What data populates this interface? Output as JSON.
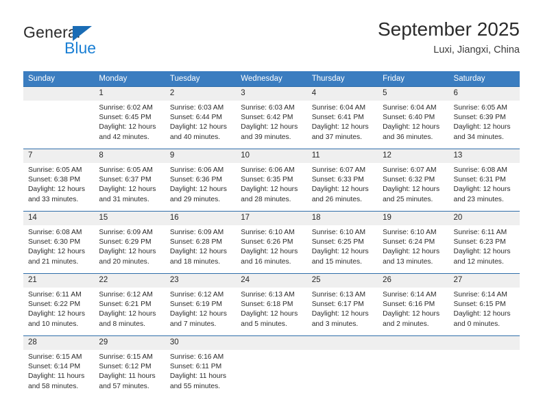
{
  "logo": {
    "word_top": "General",
    "word_bottom": "Blue",
    "triangle_color": "#1a6cb5",
    "blue_color": "#1a7fd4"
  },
  "header": {
    "title": "September 2025",
    "location": "Luxi, Jiangxi, China"
  },
  "theme": {
    "header_bg": "#3b7dc0",
    "header_text": "#ffffff",
    "daynum_bg": "#efefef",
    "row_border": "#2d6ca8",
    "body_text": "#2a2a2a"
  },
  "weekdays": [
    "Sunday",
    "Monday",
    "Tuesday",
    "Wednesday",
    "Thursday",
    "Friday",
    "Saturday"
  ],
  "labels": {
    "sunrise_prefix": "Sunrise:",
    "sunset_prefix": "Sunset:",
    "daylight_prefix": "Daylight:"
  },
  "weeks": [
    [
      {
        "day": "",
        "l1": "",
        "l2": "",
        "l3": "",
        "l4": ""
      },
      {
        "day": "1",
        "l1": "Sunrise: 6:02 AM",
        "l2": "Sunset: 6:45 PM",
        "l3": "Daylight: 12 hours",
        "l4": "and 42 minutes."
      },
      {
        "day": "2",
        "l1": "Sunrise: 6:03 AM",
        "l2": "Sunset: 6:44 PM",
        "l3": "Daylight: 12 hours",
        "l4": "and 40 minutes."
      },
      {
        "day": "3",
        "l1": "Sunrise: 6:03 AM",
        "l2": "Sunset: 6:42 PM",
        "l3": "Daylight: 12 hours",
        "l4": "and 39 minutes."
      },
      {
        "day": "4",
        "l1": "Sunrise: 6:04 AM",
        "l2": "Sunset: 6:41 PM",
        "l3": "Daylight: 12 hours",
        "l4": "and 37 minutes."
      },
      {
        "day": "5",
        "l1": "Sunrise: 6:04 AM",
        "l2": "Sunset: 6:40 PM",
        "l3": "Daylight: 12 hours",
        "l4": "and 36 minutes."
      },
      {
        "day": "6",
        "l1": "Sunrise: 6:05 AM",
        "l2": "Sunset: 6:39 PM",
        "l3": "Daylight: 12 hours",
        "l4": "and 34 minutes."
      }
    ],
    [
      {
        "day": "7",
        "l1": "Sunrise: 6:05 AM",
        "l2": "Sunset: 6:38 PM",
        "l3": "Daylight: 12 hours",
        "l4": "and 33 minutes."
      },
      {
        "day": "8",
        "l1": "Sunrise: 6:05 AM",
        "l2": "Sunset: 6:37 PM",
        "l3": "Daylight: 12 hours",
        "l4": "and 31 minutes."
      },
      {
        "day": "9",
        "l1": "Sunrise: 6:06 AM",
        "l2": "Sunset: 6:36 PM",
        "l3": "Daylight: 12 hours",
        "l4": "and 29 minutes."
      },
      {
        "day": "10",
        "l1": "Sunrise: 6:06 AM",
        "l2": "Sunset: 6:35 PM",
        "l3": "Daylight: 12 hours",
        "l4": "and 28 minutes."
      },
      {
        "day": "11",
        "l1": "Sunrise: 6:07 AM",
        "l2": "Sunset: 6:33 PM",
        "l3": "Daylight: 12 hours",
        "l4": "and 26 minutes."
      },
      {
        "day": "12",
        "l1": "Sunrise: 6:07 AM",
        "l2": "Sunset: 6:32 PM",
        "l3": "Daylight: 12 hours",
        "l4": "and 25 minutes."
      },
      {
        "day": "13",
        "l1": "Sunrise: 6:08 AM",
        "l2": "Sunset: 6:31 PM",
        "l3": "Daylight: 12 hours",
        "l4": "and 23 minutes."
      }
    ],
    [
      {
        "day": "14",
        "l1": "Sunrise: 6:08 AM",
        "l2": "Sunset: 6:30 PM",
        "l3": "Daylight: 12 hours",
        "l4": "and 21 minutes."
      },
      {
        "day": "15",
        "l1": "Sunrise: 6:09 AM",
        "l2": "Sunset: 6:29 PM",
        "l3": "Daylight: 12 hours",
        "l4": "and 20 minutes."
      },
      {
        "day": "16",
        "l1": "Sunrise: 6:09 AM",
        "l2": "Sunset: 6:28 PM",
        "l3": "Daylight: 12 hours",
        "l4": "and 18 minutes."
      },
      {
        "day": "17",
        "l1": "Sunrise: 6:10 AM",
        "l2": "Sunset: 6:26 PM",
        "l3": "Daylight: 12 hours",
        "l4": "and 16 minutes."
      },
      {
        "day": "18",
        "l1": "Sunrise: 6:10 AM",
        "l2": "Sunset: 6:25 PM",
        "l3": "Daylight: 12 hours",
        "l4": "and 15 minutes."
      },
      {
        "day": "19",
        "l1": "Sunrise: 6:10 AM",
        "l2": "Sunset: 6:24 PM",
        "l3": "Daylight: 12 hours",
        "l4": "and 13 minutes."
      },
      {
        "day": "20",
        "l1": "Sunrise: 6:11 AM",
        "l2": "Sunset: 6:23 PM",
        "l3": "Daylight: 12 hours",
        "l4": "and 12 minutes."
      }
    ],
    [
      {
        "day": "21",
        "l1": "Sunrise: 6:11 AM",
        "l2": "Sunset: 6:22 PM",
        "l3": "Daylight: 12 hours",
        "l4": "and 10 minutes."
      },
      {
        "day": "22",
        "l1": "Sunrise: 6:12 AM",
        "l2": "Sunset: 6:21 PM",
        "l3": "Daylight: 12 hours",
        "l4": "and 8 minutes."
      },
      {
        "day": "23",
        "l1": "Sunrise: 6:12 AM",
        "l2": "Sunset: 6:19 PM",
        "l3": "Daylight: 12 hours",
        "l4": "and 7 minutes."
      },
      {
        "day": "24",
        "l1": "Sunrise: 6:13 AM",
        "l2": "Sunset: 6:18 PM",
        "l3": "Daylight: 12 hours",
        "l4": "and 5 minutes."
      },
      {
        "day": "25",
        "l1": "Sunrise: 6:13 AM",
        "l2": "Sunset: 6:17 PM",
        "l3": "Daylight: 12 hours",
        "l4": "and 3 minutes."
      },
      {
        "day": "26",
        "l1": "Sunrise: 6:14 AM",
        "l2": "Sunset: 6:16 PM",
        "l3": "Daylight: 12 hours",
        "l4": "and 2 minutes."
      },
      {
        "day": "27",
        "l1": "Sunrise: 6:14 AM",
        "l2": "Sunset: 6:15 PM",
        "l3": "Daylight: 12 hours",
        "l4": "and 0 minutes."
      }
    ],
    [
      {
        "day": "28",
        "l1": "Sunrise: 6:15 AM",
        "l2": "Sunset: 6:14 PM",
        "l3": "Daylight: 11 hours",
        "l4": "and 58 minutes."
      },
      {
        "day": "29",
        "l1": "Sunrise: 6:15 AM",
        "l2": "Sunset: 6:12 PM",
        "l3": "Daylight: 11 hours",
        "l4": "and 57 minutes."
      },
      {
        "day": "30",
        "l1": "Sunrise: 6:16 AM",
        "l2": "Sunset: 6:11 PM",
        "l3": "Daylight: 11 hours",
        "l4": "and 55 minutes."
      },
      {
        "day": "",
        "l1": "",
        "l2": "",
        "l3": "",
        "l4": ""
      },
      {
        "day": "",
        "l1": "",
        "l2": "",
        "l3": "",
        "l4": ""
      },
      {
        "day": "",
        "l1": "",
        "l2": "",
        "l3": "",
        "l4": ""
      },
      {
        "day": "",
        "l1": "",
        "l2": "",
        "l3": "",
        "l4": ""
      }
    ]
  ]
}
